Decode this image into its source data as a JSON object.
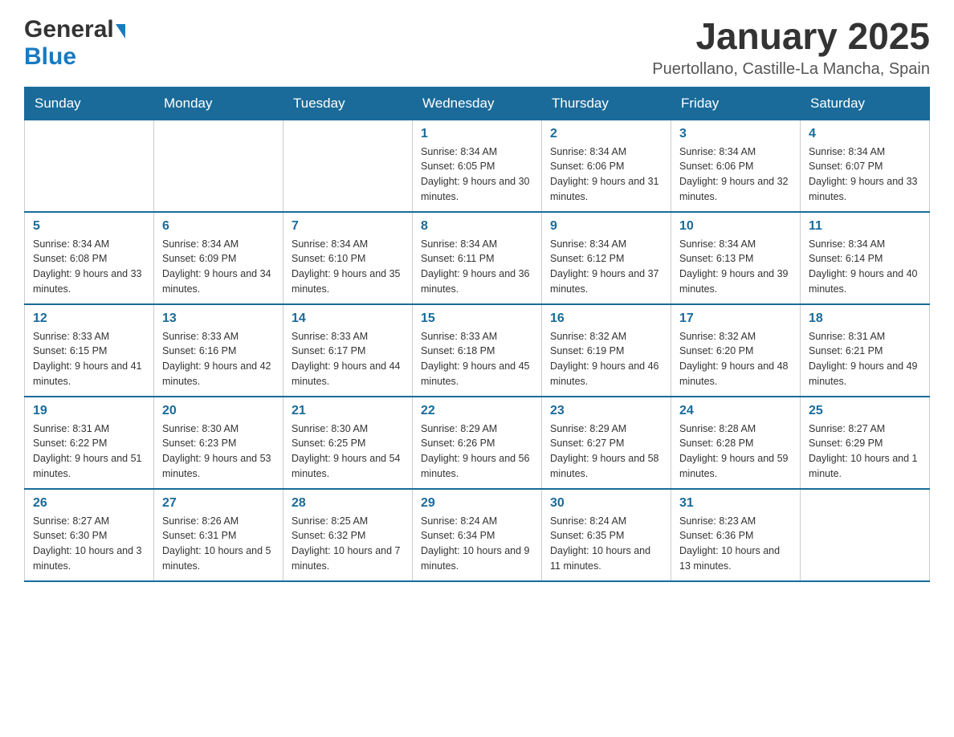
{
  "header": {
    "logo": {
      "general": "General",
      "blue": "Blue"
    },
    "title": "January 2025",
    "location": "Puertollano, Castille-La Mancha, Spain"
  },
  "calendar": {
    "weekdays": [
      "Sunday",
      "Monday",
      "Tuesday",
      "Wednesday",
      "Thursday",
      "Friday",
      "Saturday"
    ],
    "weeks": [
      [
        {
          "day": "",
          "info": ""
        },
        {
          "day": "",
          "info": ""
        },
        {
          "day": "",
          "info": ""
        },
        {
          "day": "1",
          "info": "Sunrise: 8:34 AM\nSunset: 6:05 PM\nDaylight: 9 hours and 30 minutes."
        },
        {
          "day": "2",
          "info": "Sunrise: 8:34 AM\nSunset: 6:06 PM\nDaylight: 9 hours and 31 minutes."
        },
        {
          "day": "3",
          "info": "Sunrise: 8:34 AM\nSunset: 6:06 PM\nDaylight: 9 hours and 32 minutes."
        },
        {
          "day": "4",
          "info": "Sunrise: 8:34 AM\nSunset: 6:07 PM\nDaylight: 9 hours and 33 minutes."
        }
      ],
      [
        {
          "day": "5",
          "info": "Sunrise: 8:34 AM\nSunset: 6:08 PM\nDaylight: 9 hours and 33 minutes."
        },
        {
          "day": "6",
          "info": "Sunrise: 8:34 AM\nSunset: 6:09 PM\nDaylight: 9 hours and 34 minutes."
        },
        {
          "day": "7",
          "info": "Sunrise: 8:34 AM\nSunset: 6:10 PM\nDaylight: 9 hours and 35 minutes."
        },
        {
          "day": "8",
          "info": "Sunrise: 8:34 AM\nSunset: 6:11 PM\nDaylight: 9 hours and 36 minutes."
        },
        {
          "day": "9",
          "info": "Sunrise: 8:34 AM\nSunset: 6:12 PM\nDaylight: 9 hours and 37 minutes."
        },
        {
          "day": "10",
          "info": "Sunrise: 8:34 AM\nSunset: 6:13 PM\nDaylight: 9 hours and 39 minutes."
        },
        {
          "day": "11",
          "info": "Sunrise: 8:34 AM\nSunset: 6:14 PM\nDaylight: 9 hours and 40 minutes."
        }
      ],
      [
        {
          "day": "12",
          "info": "Sunrise: 8:33 AM\nSunset: 6:15 PM\nDaylight: 9 hours and 41 minutes."
        },
        {
          "day": "13",
          "info": "Sunrise: 8:33 AM\nSunset: 6:16 PM\nDaylight: 9 hours and 42 minutes."
        },
        {
          "day": "14",
          "info": "Sunrise: 8:33 AM\nSunset: 6:17 PM\nDaylight: 9 hours and 44 minutes."
        },
        {
          "day": "15",
          "info": "Sunrise: 8:33 AM\nSunset: 6:18 PM\nDaylight: 9 hours and 45 minutes."
        },
        {
          "day": "16",
          "info": "Sunrise: 8:32 AM\nSunset: 6:19 PM\nDaylight: 9 hours and 46 minutes."
        },
        {
          "day": "17",
          "info": "Sunrise: 8:32 AM\nSunset: 6:20 PM\nDaylight: 9 hours and 48 minutes."
        },
        {
          "day": "18",
          "info": "Sunrise: 8:31 AM\nSunset: 6:21 PM\nDaylight: 9 hours and 49 minutes."
        }
      ],
      [
        {
          "day": "19",
          "info": "Sunrise: 8:31 AM\nSunset: 6:22 PM\nDaylight: 9 hours and 51 minutes."
        },
        {
          "day": "20",
          "info": "Sunrise: 8:30 AM\nSunset: 6:23 PM\nDaylight: 9 hours and 53 minutes."
        },
        {
          "day": "21",
          "info": "Sunrise: 8:30 AM\nSunset: 6:25 PM\nDaylight: 9 hours and 54 minutes."
        },
        {
          "day": "22",
          "info": "Sunrise: 8:29 AM\nSunset: 6:26 PM\nDaylight: 9 hours and 56 minutes."
        },
        {
          "day": "23",
          "info": "Sunrise: 8:29 AM\nSunset: 6:27 PM\nDaylight: 9 hours and 58 minutes."
        },
        {
          "day": "24",
          "info": "Sunrise: 8:28 AM\nSunset: 6:28 PM\nDaylight: 9 hours and 59 minutes."
        },
        {
          "day": "25",
          "info": "Sunrise: 8:27 AM\nSunset: 6:29 PM\nDaylight: 10 hours and 1 minute."
        }
      ],
      [
        {
          "day": "26",
          "info": "Sunrise: 8:27 AM\nSunset: 6:30 PM\nDaylight: 10 hours and 3 minutes."
        },
        {
          "day": "27",
          "info": "Sunrise: 8:26 AM\nSunset: 6:31 PM\nDaylight: 10 hours and 5 minutes."
        },
        {
          "day": "28",
          "info": "Sunrise: 8:25 AM\nSunset: 6:32 PM\nDaylight: 10 hours and 7 minutes."
        },
        {
          "day": "29",
          "info": "Sunrise: 8:24 AM\nSunset: 6:34 PM\nDaylight: 10 hours and 9 minutes."
        },
        {
          "day": "30",
          "info": "Sunrise: 8:24 AM\nSunset: 6:35 PM\nDaylight: 10 hours and 11 minutes."
        },
        {
          "day": "31",
          "info": "Sunrise: 8:23 AM\nSunset: 6:36 PM\nDaylight: 10 hours and 13 minutes."
        },
        {
          "day": "",
          "info": ""
        }
      ]
    ]
  }
}
